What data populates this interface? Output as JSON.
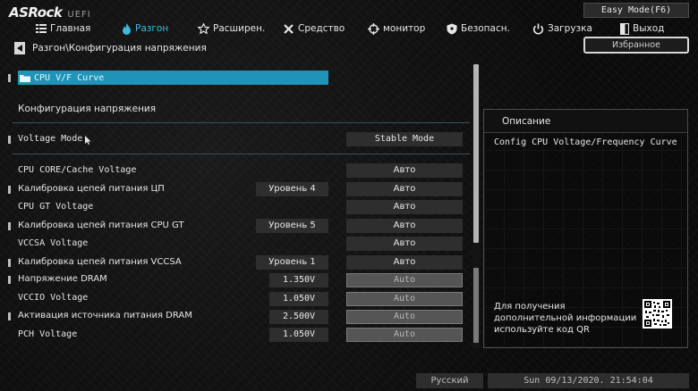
{
  "header": {
    "brand": "ASRock",
    "brand_suffix": "UEFI",
    "easy_mode": "Easy Mode(F6)",
    "favorites": "Избранное"
  },
  "tabs": [
    {
      "label": "Главная",
      "icon": "list-icon"
    },
    {
      "label": "Разгон",
      "icon": "flame-icon",
      "active": true
    },
    {
      "label": "Расширен.",
      "icon": "star-icon"
    },
    {
      "label": "Средство",
      "icon": "tools-icon"
    },
    {
      "label": "монитор",
      "icon": "crosshair-icon"
    },
    {
      "label": "Безопасн.",
      "icon": "shield-icon"
    },
    {
      "label": "Загрузка",
      "icon": "power-icon"
    },
    {
      "label": "Выход",
      "icon": "exit-icon"
    }
  ],
  "breadcrumb": "Разгон\\Конфигурация напряжения",
  "selected_item": "CPU V/F Curve",
  "section_title": "Конфигурация напряжения",
  "voltage_mode": {
    "label": "Voltage Mode",
    "value": "Stable Mode"
  },
  "settings": [
    {
      "label": "CPU CORE/Cache Voltage",
      "mid": "",
      "value": "Авто",
      "dim": false
    },
    {
      "label": "Калибровка цепей питания ЦП",
      "mid": "Уровень 4",
      "value": "Авто",
      "dim": false
    },
    {
      "label": "CPU GT Voltage",
      "mid": "",
      "value": "Авто",
      "dim": false
    },
    {
      "label": "Калибровка цепей питания CPU GT",
      "mid": "Уровень 5",
      "value": "Авто",
      "dim": false
    },
    {
      "label": "VCCSA Voltage",
      "mid": "",
      "value": "Авто",
      "dim": false
    },
    {
      "label": "Калибровка цепей питания VCCSA",
      "mid": "Уровень 1",
      "value": "Авто",
      "dim": false
    },
    {
      "label": "Напряжение DRAM",
      "mid": "1.350V",
      "value": "Auto",
      "dim": true
    },
    {
      "label": "VCCIO Voltage",
      "mid": "1.050V",
      "value": "Auto",
      "dim": true
    },
    {
      "label": "Активация источника питания DRAM",
      "mid": "2.500V",
      "value": "Auto",
      "dim": true
    },
    {
      "label": "PCH Voltage",
      "mid": "1.050V",
      "value": "Auto",
      "dim": true
    }
  ],
  "description": {
    "title": "Описание",
    "text": "Config CPU Voltage/Frequency Curve",
    "qr_hint": "Для получения дополнительной информации используйте код QR"
  },
  "footer": {
    "language": "Русский",
    "datetime": "Sun 09/13/2020. 21:54:04"
  }
}
